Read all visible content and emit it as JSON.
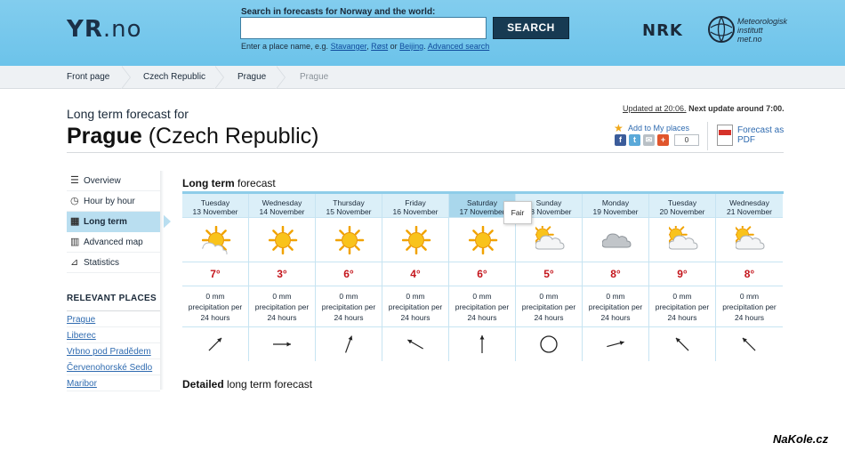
{
  "header": {
    "logo": {
      "bold": "YR",
      "rest": ".no"
    },
    "search_label": "Search in forecasts for Norway and the world:",
    "search_value": "",
    "search_button": "SEARCH",
    "hint_prefix": "Enter a place name, e.g.",
    "hint_links": [
      "Stavanger",
      "Røst",
      "Beijing"
    ],
    "hint_or": "or",
    "advanced_search": "Advanced search",
    "nrk": "NRK",
    "met_lines": [
      "Meteorologisk",
      "institutt",
      "met.no"
    ]
  },
  "breadcrumb": [
    "Front page",
    "Czech Republic",
    "Prague",
    "Prague"
  ],
  "title": {
    "label": "Long term forecast for",
    "place": "Prague",
    "country": "(Czech Republic)"
  },
  "meta": {
    "updated": "Updated at 20:06.",
    "next_update": "Next update around 7:00.",
    "add_places": "Add to My places",
    "share_count": "0",
    "pdf_line1": "Forecast as",
    "pdf_line2": "PDF"
  },
  "sidenav": [
    {
      "label": "Overview",
      "icon": "list-icon"
    },
    {
      "label": "Hour by hour",
      "icon": "clock-icon"
    },
    {
      "label": "Long term",
      "icon": "calendar-icon"
    },
    {
      "label": "Advanced map",
      "icon": "map-icon"
    },
    {
      "label": "Statistics",
      "icon": "chart-icon"
    }
  ],
  "relevant_title": "RELEVANT PLACES",
  "relevant_places": [
    "Prague",
    "Liberec",
    "Vrbno pod Pradědem",
    "Červenohorské Sedlo",
    "Maribor"
  ],
  "forecast": {
    "heading_bold": "Long term",
    "heading_rest": "forecast",
    "days": [
      {
        "day": "Tuesday",
        "date": "13 November",
        "icon": "partly-sunny-icon",
        "temp": "7°",
        "precip": [
          "0 mm",
          "precipitation per",
          "24 hours"
        ],
        "wind_deg": 225
      },
      {
        "day": "Wednesday",
        "date": "14 November",
        "icon": "sun-icon",
        "temp": "3°",
        "precip": [
          "0 mm",
          "precipitation per",
          "24 hours"
        ],
        "wind_deg": 270
      },
      {
        "day": "Thursday",
        "date": "15 November",
        "icon": "sun-icon",
        "temp": "6°",
        "precip": [
          "0 mm",
          "precipitation per",
          "24 hours"
        ],
        "wind_deg": 200
      },
      {
        "day": "Friday",
        "date": "16 November",
        "icon": "sun-icon",
        "temp": "4°",
        "precip": [
          "0 mm",
          "precipitation per",
          "24 hours"
        ],
        "wind_deg": 120
      },
      {
        "day": "Saturday",
        "date": "17 November",
        "icon": "sun-icon",
        "temp": "6°",
        "precip": [
          "0 mm",
          "precipitation per",
          "24 hours"
        ],
        "wind_deg": 180
      },
      {
        "day": "Sunday",
        "date": "18 November",
        "icon": "sun-cloud-icon",
        "temp": "5°",
        "precip": [
          "0 mm",
          "precipitation per",
          "24 hours"
        ],
        "wind_deg": null
      },
      {
        "day": "Monday",
        "date": "19 November",
        "icon": "cloud-icon",
        "temp": "8°",
        "precip": [
          "0 mm",
          "precipitation per",
          "24 hours"
        ],
        "wind_deg": 255
      },
      {
        "day": "Tuesday",
        "date": "20 November",
        "icon": "sun-cloud-icon",
        "temp": "9°",
        "precip": [
          "0 mm",
          "precipitation per",
          "24 hours"
        ],
        "wind_deg": 135
      },
      {
        "day": "Wednesday",
        "date": "21 November",
        "icon": "sun-cloud-icon",
        "temp": "8°",
        "precip": [
          "0 mm",
          "precipitation per",
          "24 hours"
        ],
        "wind_deg": 135
      }
    ],
    "selected_index": 4,
    "tooltip": "Fair"
  },
  "detailed_bold": "Detailed",
  "detailed_rest": "long term forecast",
  "watermark": "NaKole.cz",
  "colors": {
    "header": "#6cc3ea",
    "temp": "#c4151c",
    "link": "#2f6bb0",
    "active_nav": "#b9def0"
  }
}
